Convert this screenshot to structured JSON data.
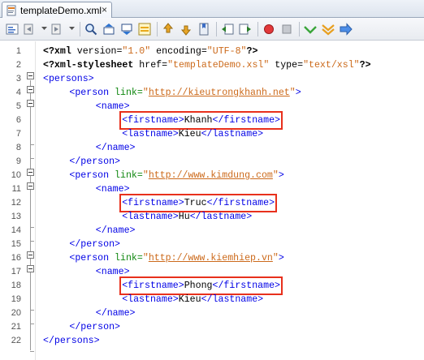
{
  "tab": {
    "title": "templateDemo.xml",
    "close_label": "×"
  },
  "toolbar": {
    "buttons": [
      "source-view-icon",
      "back-icon",
      "forward-icon",
      "find-icon",
      "find-previous-icon",
      "find-next-icon",
      "toggle-highlight-icon",
      "previous-bookmark-icon",
      "next-bookmark-icon",
      "toggle-bookmark-icon",
      "shift-left-icon",
      "shift-right-icon",
      "start-macro-icon",
      "stop-macro-icon",
      "check-xml-icon",
      "validate-xml-icon",
      "run-xsl-icon"
    ]
  },
  "editor": {
    "lines": [
      {
        "n": "1",
        "indent": 0,
        "tokens": [
          [
            "pi",
            "<?xml"
          ],
          [
            "txt",
            " version="
          ],
          [
            "str",
            "\"1.0\""
          ],
          [
            "txt",
            " encoding="
          ],
          [
            "str",
            "\"UTF-8\""
          ],
          [
            "pi",
            "?>"
          ]
        ]
      },
      {
        "n": "2",
        "indent": 0,
        "tokens": [
          [
            "pi",
            "<?xml-stylesheet"
          ],
          [
            "txt",
            " href="
          ],
          [
            "str",
            "\"templateDemo.xsl\""
          ],
          [
            "txt",
            " type="
          ],
          [
            "str",
            "\"text/xsl\""
          ],
          [
            "pi",
            "?>"
          ]
        ]
      },
      {
        "n": "3",
        "indent": 0,
        "tokens": [
          [
            "tag",
            "<persons>"
          ]
        ]
      },
      {
        "n": "4",
        "indent": 1,
        "tokens": [
          [
            "tag",
            "<person"
          ],
          [
            "attr",
            " link="
          ],
          [
            "str",
            "\""
          ],
          [
            "link",
            "http://kieutrongkhanh.net"
          ],
          [
            "str",
            "\""
          ],
          [
            "tag",
            ">"
          ]
        ]
      },
      {
        "n": "5",
        "indent": 2,
        "tokens": [
          [
            "tag",
            "<name>"
          ]
        ]
      },
      {
        "n": "6",
        "indent": 3,
        "tokens": [
          [
            "tag",
            "<firstname>"
          ],
          [
            "txt",
            "Khanh"
          ],
          [
            "tag",
            "</firstname>"
          ]
        ]
      },
      {
        "n": "7",
        "indent": 3,
        "tokens": [
          [
            "tag",
            "<lastname>"
          ],
          [
            "txt",
            "Kieu"
          ],
          [
            "tag",
            "</lastname>"
          ]
        ]
      },
      {
        "n": "8",
        "indent": 2,
        "tokens": [
          [
            "tag",
            "</name>"
          ]
        ]
      },
      {
        "n": "9",
        "indent": 1,
        "tokens": [
          [
            "tag",
            "</person>"
          ]
        ]
      },
      {
        "n": "10",
        "indent": 1,
        "tokens": [
          [
            "tag",
            "<person"
          ],
          [
            "attr",
            " link="
          ],
          [
            "str",
            "\""
          ],
          [
            "link",
            "http://www.kimdung.com"
          ],
          [
            "str",
            "\""
          ],
          [
            "tag",
            ">"
          ]
        ]
      },
      {
        "n": "11",
        "indent": 2,
        "tokens": [
          [
            "tag",
            "<name>"
          ]
        ]
      },
      {
        "n": "12",
        "indent": 3,
        "tokens": [
          [
            "tag",
            "<firstname>"
          ],
          [
            "txt",
            "Truc"
          ],
          [
            "tag",
            "</firstname>"
          ]
        ]
      },
      {
        "n": "13",
        "indent": 3,
        "tokens": [
          [
            "tag",
            "<lastname>"
          ],
          [
            "txt",
            "Hu"
          ],
          [
            "tag",
            "</lastname>"
          ]
        ]
      },
      {
        "n": "14",
        "indent": 2,
        "tokens": [
          [
            "tag",
            "</name>"
          ]
        ]
      },
      {
        "n": "15",
        "indent": 1,
        "tokens": [
          [
            "tag",
            "</person>"
          ]
        ]
      },
      {
        "n": "16",
        "indent": 1,
        "tokens": [
          [
            "tag",
            "<person"
          ],
          [
            "attr",
            " link="
          ],
          [
            "str",
            "\""
          ],
          [
            "link",
            "http://www.kiemhiep.vn"
          ],
          [
            "str",
            "\""
          ],
          [
            "tag",
            ">"
          ]
        ]
      },
      {
        "n": "17",
        "indent": 2,
        "tokens": [
          [
            "tag",
            "<name>"
          ]
        ]
      },
      {
        "n": "18",
        "indent": 3,
        "tokens": [
          [
            "tag",
            "<firstname>"
          ],
          [
            "txt",
            "Phong"
          ],
          [
            "tag",
            "</firstname>"
          ]
        ]
      },
      {
        "n": "19",
        "indent": 3,
        "tokens": [
          [
            "tag",
            "<lastname>"
          ],
          [
            "txt",
            "Kieu"
          ],
          [
            "tag",
            "</lastname>"
          ]
        ]
      },
      {
        "n": "20",
        "indent": 2,
        "tokens": [
          [
            "tag",
            "</name>"
          ]
        ]
      },
      {
        "n": "21",
        "indent": 1,
        "tokens": [
          [
            "tag",
            "</person>"
          ]
        ]
      },
      {
        "n": "22",
        "indent": 0,
        "tokens": [
          [
            "tag",
            "</persons>"
          ]
        ]
      }
    ],
    "highlighted_lines": [
      6,
      12,
      18
    ]
  },
  "colors": {
    "tag": "#0000e6",
    "attribute": "#118811",
    "string": "#cc6a1b",
    "highlight_box": "#e8301c"
  }
}
